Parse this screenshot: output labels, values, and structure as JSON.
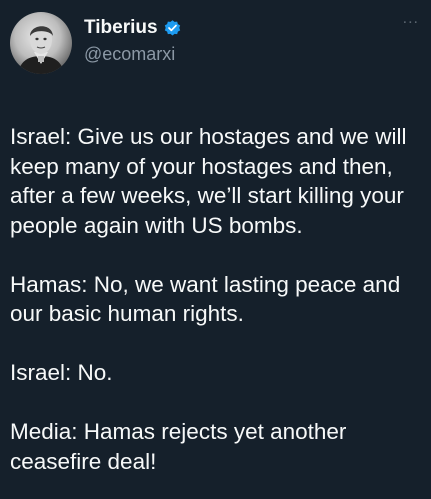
{
  "tweet": {
    "author": {
      "display_name": "Tiberius",
      "handle": "@ecomarxi",
      "verified": true,
      "avatar_icon": "portrait-avatar"
    },
    "more_label": "...",
    "paragraphs": [
      "Israel: Give us our hostages and we will keep many of your hostages and then, after a few weeks, we’ll start killing your people again with US bombs.",
      "Hamas: No, we want lasting peace and our basic human rights.",
      "Israel: No.",
      "Media: Hamas rejects yet another ceasefire deal!"
    ]
  },
  "colors": {
    "background": "#15202b",
    "text": "#f7f9f9",
    "secondary_text": "#8b98a5",
    "verified_badge": "#1d9bf0"
  }
}
